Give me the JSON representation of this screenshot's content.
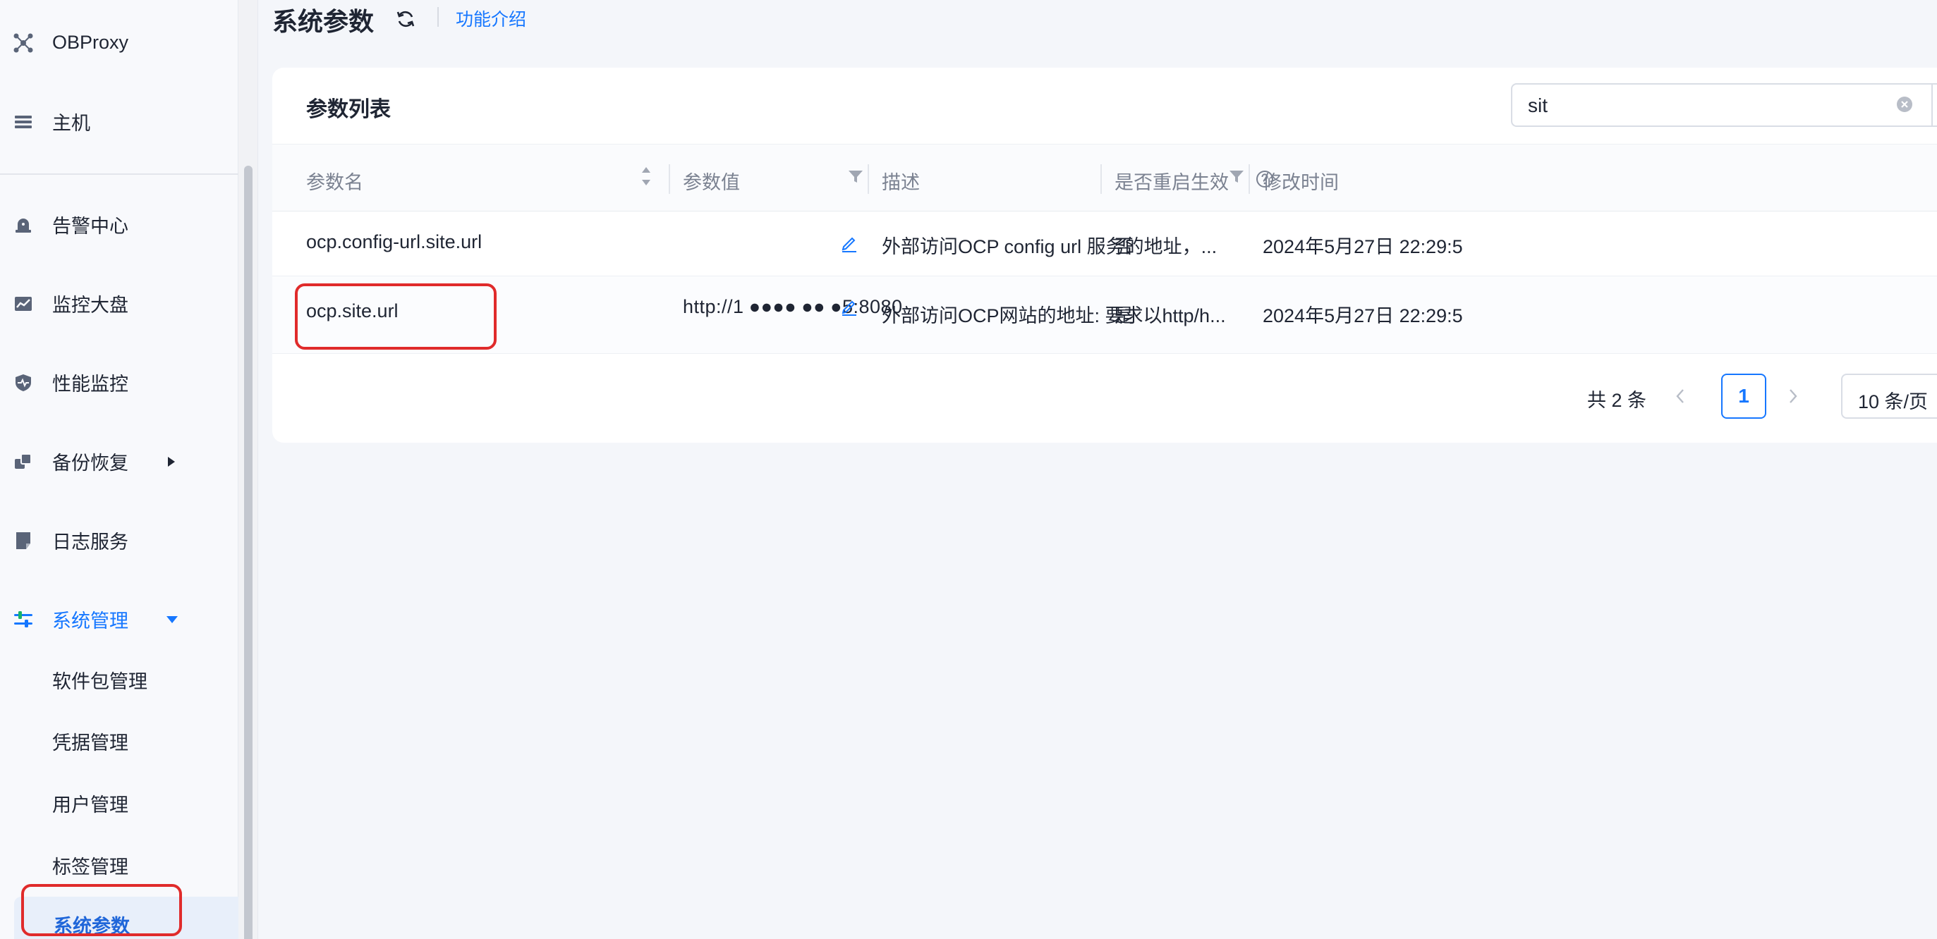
{
  "sidebar": {
    "items": [
      {
        "label": "OBProxy",
        "icon": "obproxy-icon"
      },
      {
        "label": "主机",
        "icon": "host-list-icon"
      },
      {
        "label": "告警中心",
        "icon": "alarm-bell-icon"
      },
      {
        "label": "监控大盘",
        "icon": "monitor-chart-icon"
      },
      {
        "label": "性能监控",
        "icon": "performance-shield-icon"
      },
      {
        "label": "备份恢复",
        "icon": "backup-icon"
      },
      {
        "label": "日志服务",
        "icon": "log-icon"
      },
      {
        "label": "系统管理",
        "icon": "system-settings-icon"
      }
    ],
    "sub_items": [
      {
        "label": "软件包管理"
      },
      {
        "label": "凭据管理"
      },
      {
        "label": "用户管理"
      },
      {
        "label": "标签管理"
      },
      {
        "label": "系统参数"
      }
    ],
    "active_color": "#1677ff"
  },
  "header": {
    "title": "系统参数",
    "help_link": "功能介绍"
  },
  "card": {
    "title": "参数列表",
    "search": {
      "value": "sit"
    }
  },
  "table": {
    "columns": [
      "参数名",
      "参数值",
      "描述",
      "是否重启生效",
      "修改时间"
    ],
    "rows": [
      {
        "name": "ocp.config-url.site.url",
        "value": "",
        "description": "外部访问OCP config url 服务的地址，...",
        "restart": "否",
        "modified": "2024年5月27日 22:29:5"
      },
      {
        "name": "ocp.site.url",
        "value": "http://1 ●●●● ●● ●5:8080",
        "description": "外部访问OCP网站的地址: 要求以http/h...",
        "restart": "是",
        "modified": "2024年5月27日 22:29:5"
      }
    ]
  },
  "pagination": {
    "total": "共 2 条",
    "current": "1",
    "page_size": "10 条/页"
  },
  "colors": {
    "accent": "#1677ff",
    "annotation": "#e02b2b"
  }
}
